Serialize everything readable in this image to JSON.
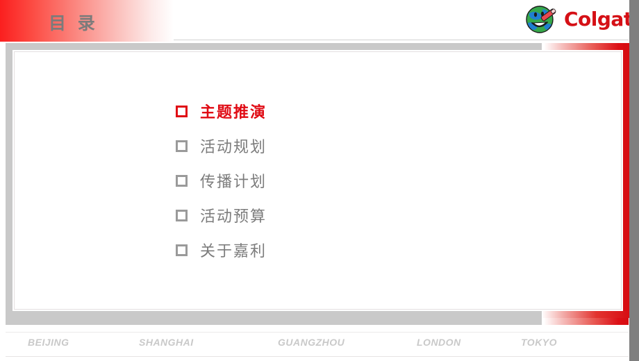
{
  "header": {
    "title": "目 录",
    "brand": {
      "name": "Colgate",
      "globe_icon": "globe-smile-toothbrush-icon",
      "color": "#d51016"
    },
    "band_color_start": "#fb1f1f",
    "band_color_end": "#ffffff"
  },
  "toc": {
    "items": [
      {
        "label": "主题推演",
        "bullet": "hollow-square-bullet",
        "active": true,
        "color": "#e00b14"
      },
      {
        "label": "活动规划",
        "bullet": "hollow-square-bullet",
        "active": false,
        "color": "#7c7c7c"
      },
      {
        "label": "传播计划",
        "bullet": "hollow-square-bullet",
        "active": false,
        "color": "#7c7c7c"
      },
      {
        "label": "活动预算",
        "bullet": "hollow-square-bullet",
        "active": false,
        "color": "#7c7c7c"
      },
      {
        "label": "关于嘉利",
        "bullet": "hollow-square-bullet",
        "active": false,
        "color": "#7c7c7c"
      }
    ]
  },
  "footer": {
    "cities": [
      "BEIJING",
      "SHANGHAI",
      "GUANGZHOU",
      "LONDON",
      "TOKYO"
    ],
    "color": "#c9c9c9"
  },
  "theme": {
    "accent_red": "#d70d12",
    "frame_gray": "#c9c9c9",
    "text_gray": "#7c7c7c"
  }
}
